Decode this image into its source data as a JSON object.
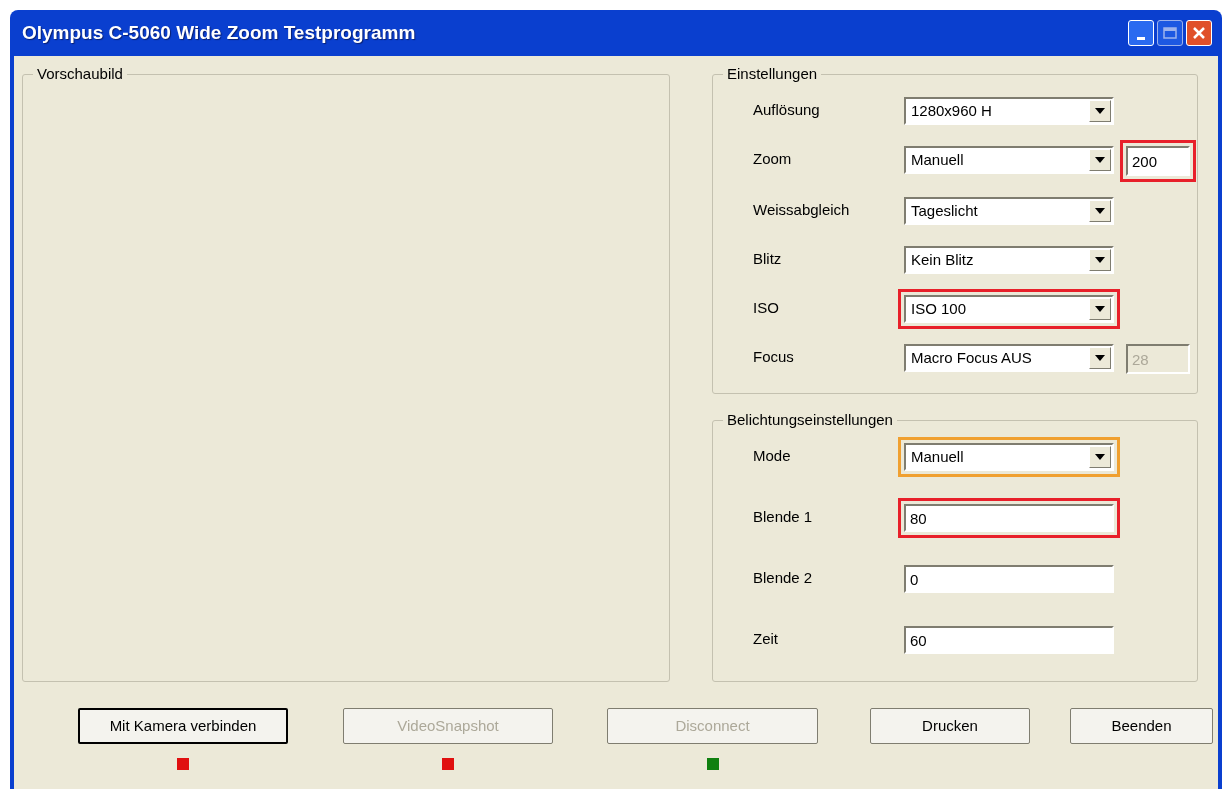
{
  "window": {
    "title": "Olympus C-5060 Wide Zoom Testprogramm"
  },
  "preview": {
    "label": "Vorschaubild"
  },
  "settings": {
    "label": "Einstellungen",
    "rows": [
      {
        "label": "Auflösung",
        "kind": "combo",
        "value": "1280x960 H"
      },
      {
        "label": "Zoom",
        "kind": "combo",
        "value": "Manuell",
        "extra": {
          "value": "200",
          "disabled": false,
          "color": "#e8202a"
        }
      },
      {
        "label": "Weissabgleich",
        "kind": "combo",
        "value": "Tageslicht"
      },
      {
        "label": "Blitz",
        "kind": "combo",
        "value": "Kein Blitz"
      },
      {
        "label": "ISO",
        "kind": "combo",
        "value": "ISO 100",
        "color": "#e8202a"
      },
      {
        "label": "Focus",
        "kind": "combo",
        "value": "Macro Focus AUS",
        "extra": {
          "value": "28",
          "disabled": true
        }
      }
    ]
  },
  "exposure": {
    "label": "Belichtungseinstellungen",
    "rows": [
      {
        "label": "Mode",
        "kind": "combo",
        "value": "Manuell",
        "color": "#f0a030"
      },
      {
        "label": "Blende 1",
        "kind": "text",
        "value": "80",
        "color": "#e8202a"
      },
      {
        "label": "Blende 2",
        "kind": "text",
        "value": "0"
      },
      {
        "label": "Zeit",
        "kind": "text",
        "value": "60"
      }
    ]
  },
  "buttons": [
    {
      "label": "Mit Kamera verbinden",
      "disabled": false,
      "focused": true,
      "color": "#e01010"
    },
    {
      "label": "VideoSnapshot",
      "disabled": true,
      "focused": false,
      "color": "#e01010"
    },
    {
      "label": "Disconnect",
      "disabled": true,
      "focused": false,
      "color": "#108010"
    },
    {
      "label": "Drucken",
      "disabled": false,
      "focused": false
    },
    {
      "label": "Beenden",
      "disabled": false,
      "focused": false
    }
  ]
}
